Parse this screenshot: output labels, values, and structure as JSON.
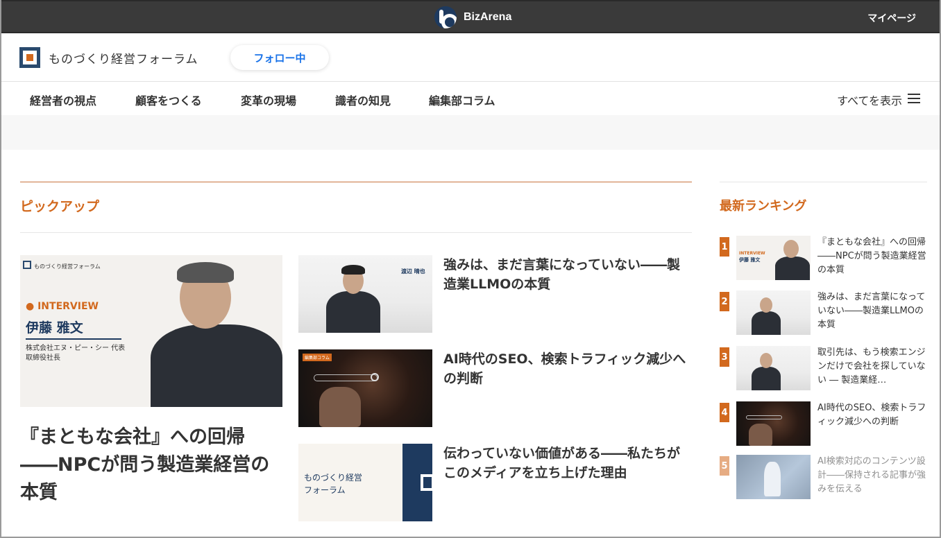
{
  "topbar": {
    "brand": "BizArena",
    "mypage": "マイページ"
  },
  "header": {
    "site_name": "ものづくり経営フォーラム",
    "follow": "フォロー中"
  },
  "nav": {
    "items": [
      "経営者の視点",
      "顧客をつくる",
      "変革の現場",
      "識者の知見",
      "編集部コラム"
    ],
    "show_all": "すべてを表示"
  },
  "pickup": {
    "title": "ピックアップ",
    "main": {
      "image_logo": "ものづくり経営フォーラム",
      "image_label": "INTERVIEW",
      "image_name": "伊藤 雅文",
      "image_company": "株式会社エヌ・ピー・シー 代表取締役社長",
      "title": "『まともな会社』への回帰――NPCが問う製造業経営の本質"
    },
    "items": [
      {
        "title": "強みは、まだ言葉になっていない――製造業LLMOの本質",
        "image_caption": "渡辺 晴也"
      },
      {
        "title": "AI時代のSEO、検索トラフィック減少への判断",
        "image_caption": "編集部コラム"
      },
      {
        "title": "伝わっていない価値がある――私たちがこのメディアを立ち上げた理由",
        "image_caption": "ものづくり経営\nフォーラム"
      }
    ]
  },
  "ranking": {
    "title": "最新ランキング",
    "items": [
      {
        "rank": "1",
        "title": "『まともな会社』への回帰――NPCが問う製造業経営の本質"
      },
      {
        "rank": "2",
        "title": "強みは、まだ言葉になっていない――製造業LLMOの本質"
      },
      {
        "rank": "3",
        "title": "取引先は、もう検索エンジンだけで会社を探していない ― 製造業経…"
      },
      {
        "rank": "4",
        "title": "AI時代のSEO、検索トラフィック減少への判断"
      },
      {
        "rank": "5",
        "title": "AI検索対応のコンテンツ設計――保持される記事が強みを伝える"
      }
    ]
  },
  "colors": {
    "accent": "#d2691e",
    "topbar": "#3a3a3a",
    "follow": "#1a73e8",
    "navy": "#1e3a5f"
  }
}
